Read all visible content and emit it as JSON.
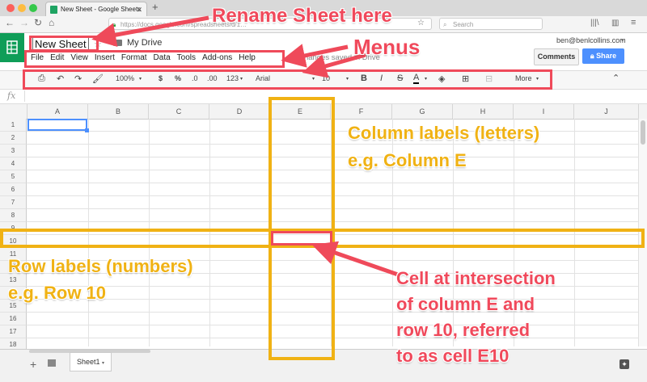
{
  "browser": {
    "tab_title": "New Sheet - Google Sheets",
    "url": "https://docs.google.com/spreadsheets/d/1…",
    "search_placeholder": "Search"
  },
  "sheets": {
    "doc_title": "New Sheet",
    "folder": "My Drive",
    "account": "ben@benlcollins.com",
    "saved_status": "All changes saved in Drive",
    "comments_label": "Comments",
    "share_label": "Share",
    "menus": [
      "File",
      "Edit",
      "View",
      "Insert",
      "Format",
      "Data",
      "Tools",
      "Add-ons",
      "Help"
    ],
    "toolbar": {
      "zoom": "100%",
      "currency": "$",
      "percent": "%",
      "dec_less": ".0",
      "dec_more": ".00",
      "more_formats": "123",
      "font": "Arial",
      "font_size": "10",
      "bold": "B",
      "italic": "I",
      "strike": "S",
      "text_color": "A",
      "more": "More"
    },
    "fx_label": "fx",
    "columns": [
      "A",
      "B",
      "C",
      "D",
      "E",
      "F",
      "G",
      "H",
      "I",
      "J"
    ],
    "rows": [
      "1",
      "2",
      "3",
      "4",
      "5",
      "6",
      "7",
      "8",
      "9",
      "10",
      "11",
      "12",
      "13",
      "14",
      "15",
      "16",
      "17",
      "18"
    ],
    "sheet_tab": "Sheet1"
  },
  "annotations": {
    "rename": "Rename Sheet here",
    "menus": "Menus",
    "column_labels": "Column labels (letters)",
    "column_example": "e.g. Column E",
    "row_labels": "Row labels (numbers)",
    "row_example": "e.g. Row 10",
    "cell_line1": "Cell at intersection",
    "cell_line2": "of column E and",
    "cell_line3": "row 10, referred",
    "cell_line4": "to as cell E10"
  },
  "colors": {
    "annotation_red": "#f0495b",
    "annotation_yellow": "#f0b214",
    "sheets_green": "#0f9d58",
    "share_blue": "#4d90fe"
  }
}
